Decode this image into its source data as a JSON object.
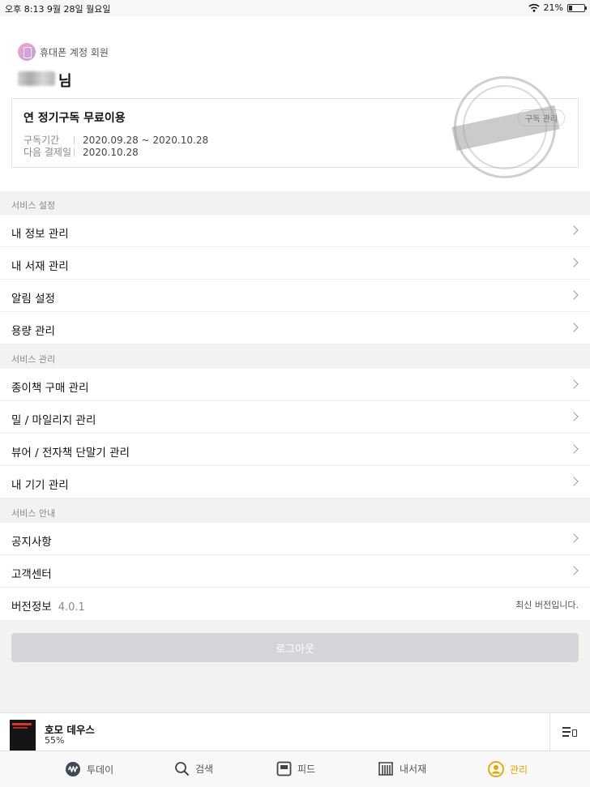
{
  "status_bar": {
    "time_date": "오후 8:13   9월 28일 월요일",
    "battery": "21%",
    "battery_level": 0.21
  },
  "profile": {
    "account_type": "휴대폰 계정 회원",
    "honorific": "님",
    "subscription": {
      "title": "연 정기구독 무료이용",
      "period_label": "구독기간",
      "period_value": "2020.09.28 ~ 2020.10.28",
      "next_payment_label": "다음 결제일",
      "next_payment_value": "2020.10.28",
      "manage_label": "구독 관리"
    }
  },
  "sections": {
    "service_settings": {
      "header": "서비스 설정",
      "items": [
        "내 정보 관리",
        "내 서재 관리",
        "알림 설정",
        "용량 관리"
      ]
    },
    "service_management": {
      "header": "서비스 관리",
      "items": [
        "종이책 구매 관리",
        "밀 / 마일리지 관리",
        "뷰어 / 전자책 단말기 관리",
        "내 기기 관리"
      ]
    },
    "service_info": {
      "header": "서비스 안내",
      "items": [
        "공지사항",
        "고객센터"
      ],
      "version_label": "버전정보",
      "version_number": "4.0.1",
      "version_note": "최신 버전입니다."
    }
  },
  "logout_label": "로그아웃",
  "now_reading": {
    "title": "호모 데우스",
    "progress": "55%"
  },
  "tabs": [
    {
      "label": "투데이",
      "icon": "today-wave-icon"
    },
    {
      "label": "검색",
      "icon": "search-icon"
    },
    {
      "label": "피드",
      "icon": "feed-icon"
    },
    {
      "label": "내서재",
      "icon": "bookshelf-icon"
    },
    {
      "label": "관리",
      "icon": "person-icon",
      "active": true
    }
  ],
  "colors": {
    "accent": "#e8a400",
    "logout_button": "#d3d5d9",
    "section_background": "#f2f2f2"
  }
}
